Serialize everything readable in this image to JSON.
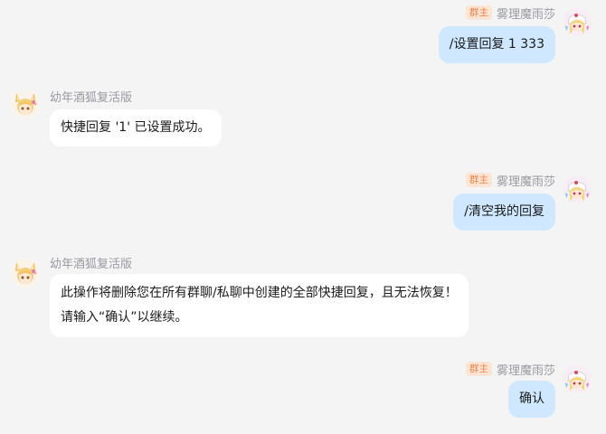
{
  "messages": [
    {
      "side": "right",
      "sender": "雾理魔雨莎",
      "badge": "群主",
      "avatar_icon": "blonde-vampire-avatar",
      "lines": [
        "/设置回复 1 333"
      ]
    },
    {
      "side": "left",
      "sender": "幼年酒狐复活版",
      "avatar_icon": "fox-girl-avatar",
      "lines": [
        "快捷回复 '1' 已设置成功。"
      ]
    },
    {
      "side": "right",
      "sender": "雾理魔雨莎",
      "badge": "群主",
      "avatar_icon": "blonde-vampire-avatar",
      "lines": [
        "/清空我的回复"
      ]
    },
    {
      "side": "left",
      "sender": "幼年酒狐复活版",
      "avatar_icon": "fox-girl-avatar",
      "lines": [
        "此操作将删除您在所有群聊/私聊中创建的全部快捷回复，且无法恢复！",
        "请输入“确认”以继续。"
      ]
    },
    {
      "side": "right",
      "sender": "雾理魔雨莎",
      "badge": "群主",
      "avatar_icon": "blonde-vampire-avatar",
      "lines": [
        "确认"
      ]
    }
  ],
  "colors": {
    "background": "#f4f4f5",
    "self_bubble": "#cfe8ff",
    "other_bubble": "#ffffff",
    "badge_bg": "#ffe5d3",
    "badge_text": "#f0844a",
    "name_text": "#999aa0"
  }
}
